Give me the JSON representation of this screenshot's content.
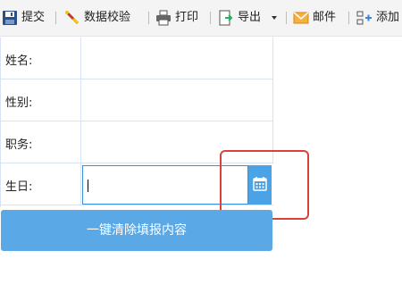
{
  "toolbar": {
    "submit_label": "提交",
    "validate_label": "数据校验",
    "print_label": "打印",
    "export_label": "导出",
    "mail_label": "邮件",
    "add_label": "添加"
  },
  "form": {
    "name_label": "姓名:",
    "gender_label": "性别:",
    "position_label": "职务:",
    "birthday_label": "生日:",
    "birthday_value": ""
  },
  "actions": {
    "clear_label": "一键清除填报内容"
  },
  "colors": {
    "accent": "#4aa3e6",
    "clear_button": "#5aa9e6",
    "highlight": "#d9413a",
    "grid_line": "#d6e4f5"
  }
}
